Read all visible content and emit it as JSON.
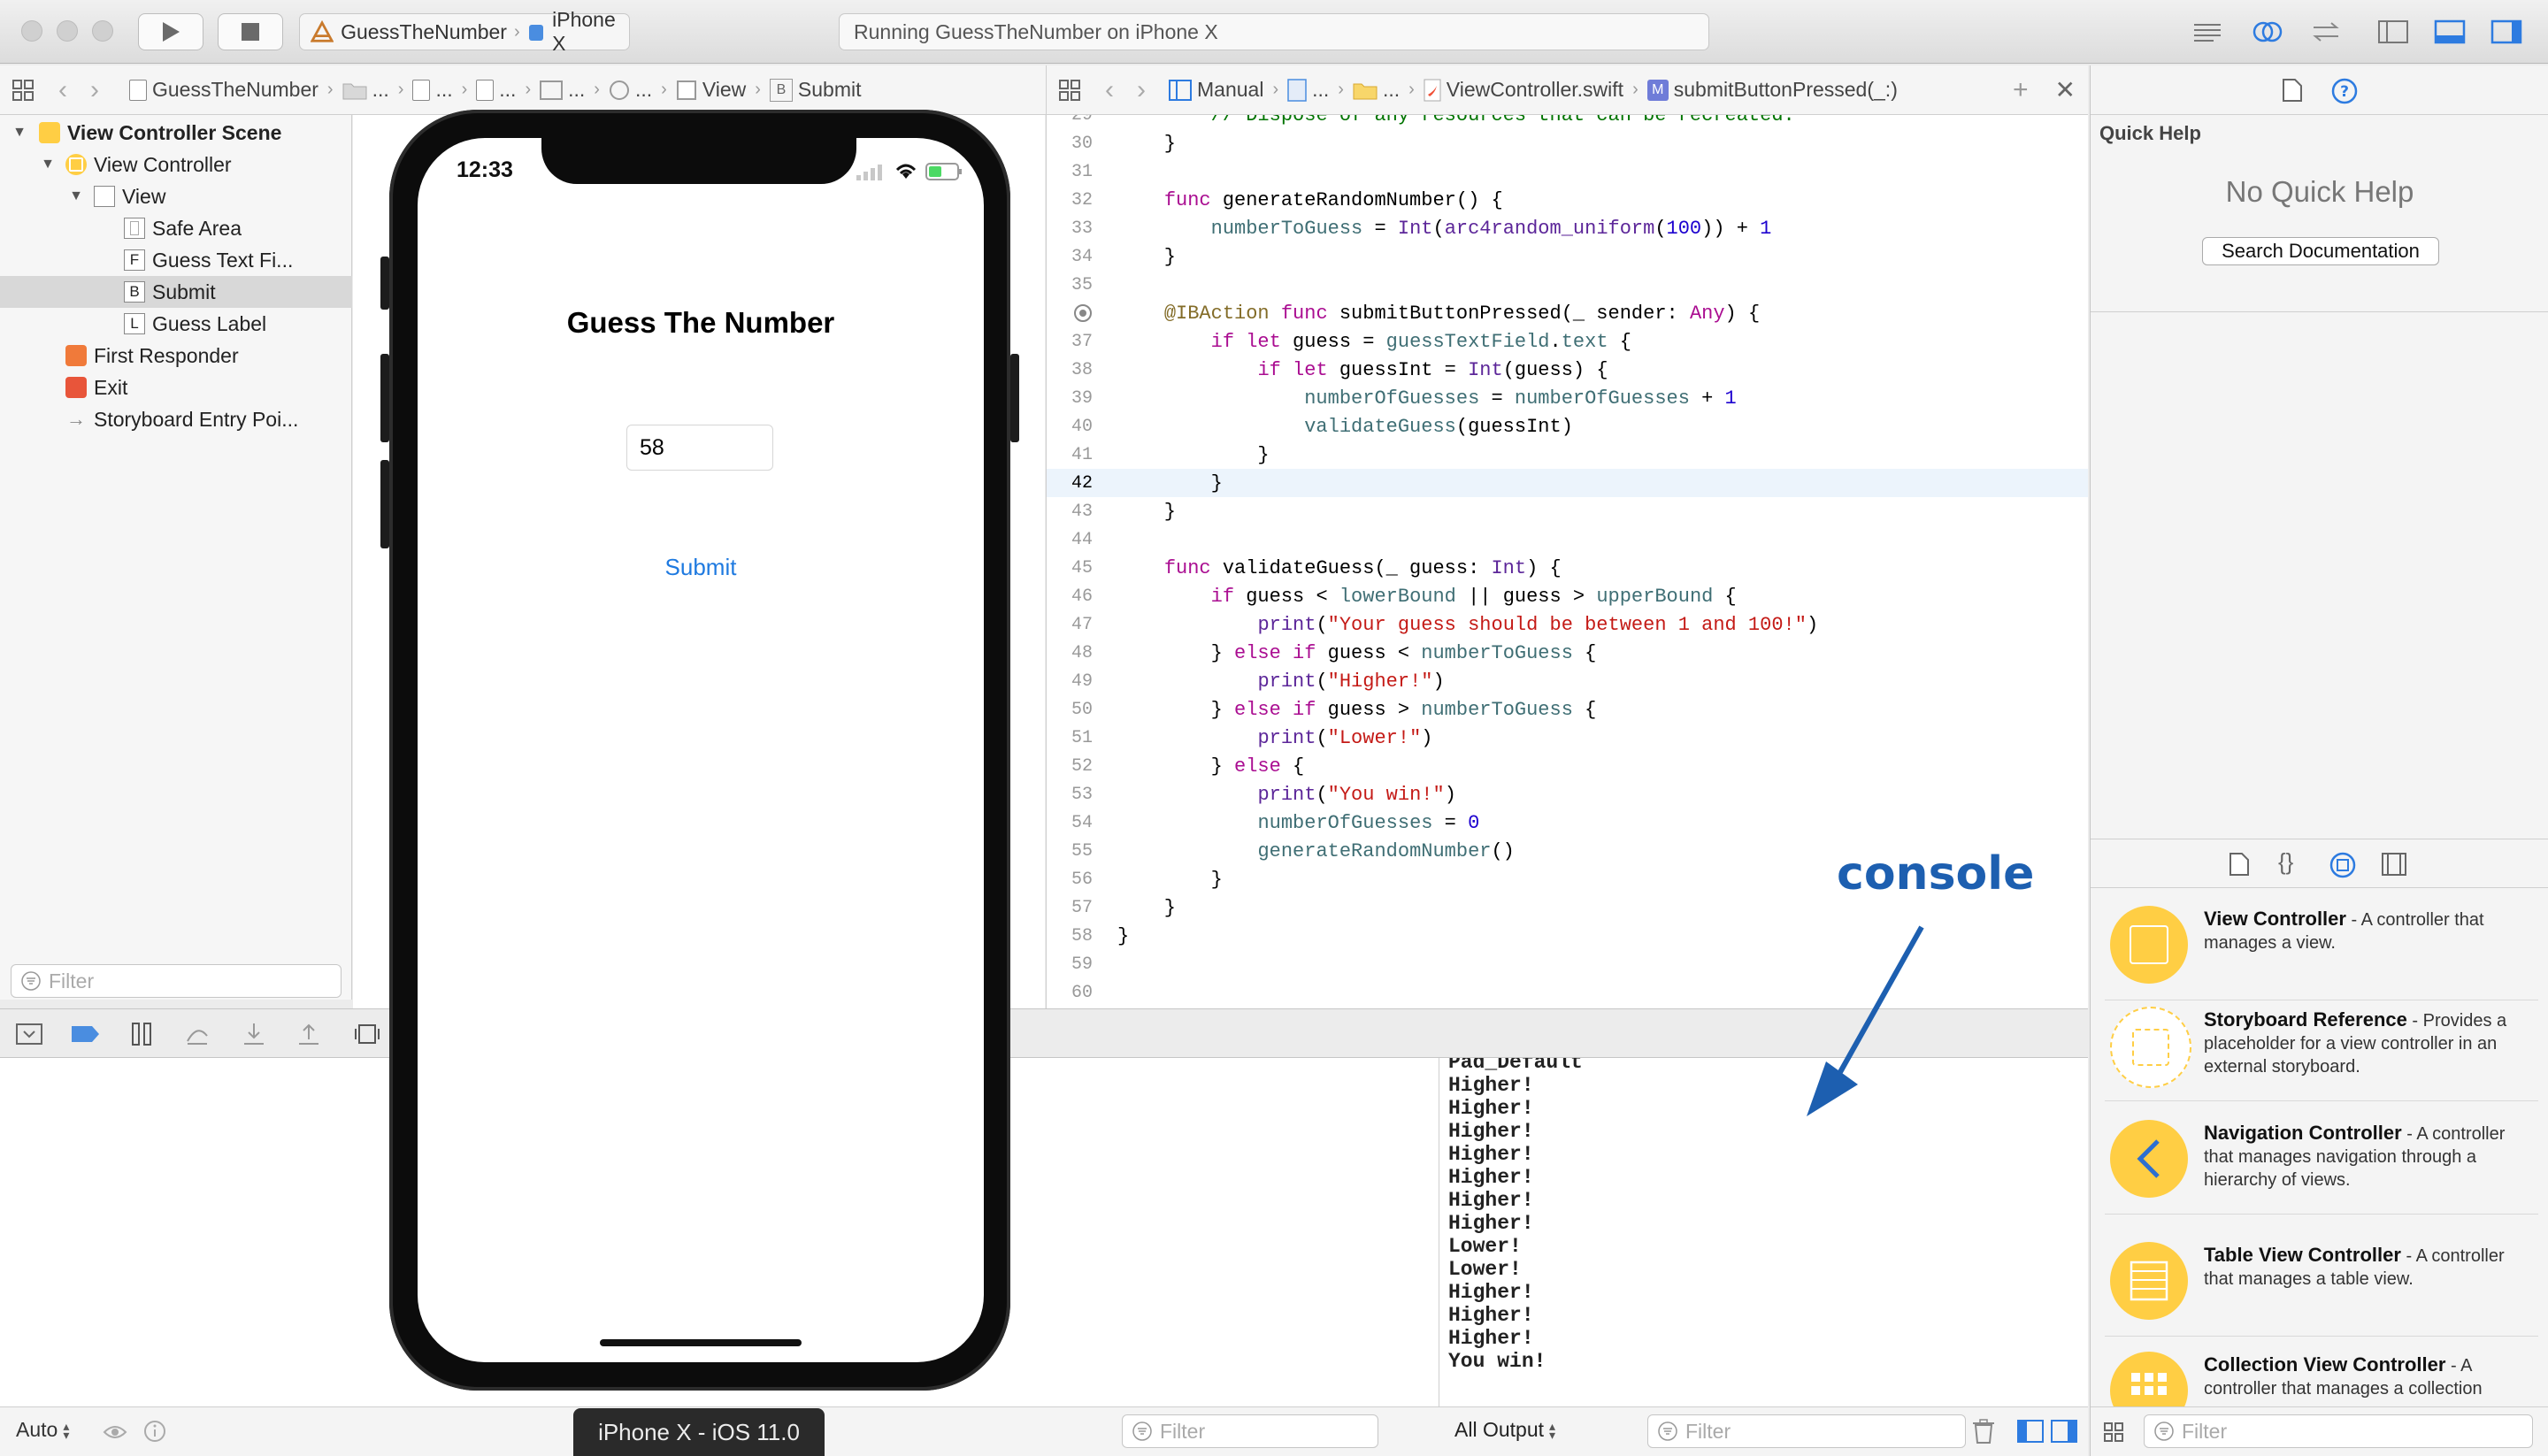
{
  "toolbar": {
    "scheme": "GuessTheNumber",
    "device": "iPhone X",
    "activity": "Running GuessTheNumber on iPhone X"
  },
  "left_jumpbar": {
    "project": "GuessTheNumber",
    "ellipsis": "...",
    "view": "View",
    "submit": "Submit",
    "submit_badge": "B"
  },
  "right_jumpbar": {
    "manual": "Manual",
    "ellipsis": "...",
    "file": "ViewController.swift",
    "method_badge": "M",
    "method": "submitButtonPressed(_:)"
  },
  "outline": {
    "scene": "View Controller Scene",
    "items": [
      {
        "label": "View Controller",
        "icon": "view-controller-icon"
      },
      {
        "label": "View",
        "icon": "view-icon"
      },
      {
        "label": "Safe Area",
        "icon": "safe-area-icon"
      },
      {
        "label": "Guess Text Fi...",
        "icon": "text-field-icon",
        "badge": "F"
      },
      {
        "label": "Submit",
        "icon": "button-icon",
        "badge": "B"
      },
      {
        "label": "Guess Label",
        "icon": "label-icon",
        "badge": "L"
      },
      {
        "label": "First Responder",
        "icon": "first-responder-icon"
      },
      {
        "label": "Exit",
        "icon": "exit-icon"
      },
      {
        "label": "Storyboard Entry Poi...",
        "icon": "entry-point-icon"
      }
    ],
    "filter_placeholder": "Filter"
  },
  "simulator": {
    "time": "12:33",
    "title": "Guess The Number",
    "text_field_value": "58",
    "submit_label": "Submit",
    "device_label": "iPhone X - iOS 11.0"
  },
  "code": {
    "first_line_partial": "// Dispose of any resources that can be recreated.",
    "current_line": 42
  },
  "annotation": {
    "label": "console"
  },
  "console": {
    "lines": [
      "Pad_Default",
      "Higher!",
      "Higher!",
      "Higher!",
      "Higher!",
      "Higher!",
      "Higher!",
      "Higher!",
      "Lower!",
      "Lower!",
      "Higher!",
      "Higher!",
      "Higher!",
      "You win!"
    ],
    "output_select": "All Output",
    "filter_placeholder": "Filter"
  },
  "debug_area": {
    "auto_select": "Auto",
    "filter_placeholder": "Filter"
  },
  "quick_help": {
    "title": "Quick Help",
    "empty": "No Quick Help",
    "search_button": "Search Documentation"
  },
  "library": {
    "items": [
      {
        "name": "View Controller",
        "desc": " - A controller that manages a view."
      },
      {
        "name": "Storyboard Reference",
        "desc": " - Provides a placeholder for a view controller in an external storyboard."
      },
      {
        "name": "Navigation Controller",
        "desc": " - A controller that manages navigation through a hierarchy of views."
      },
      {
        "name": "Table View Controller",
        "desc": " - A controller that manages a table view."
      },
      {
        "name": "Collection View Controller",
        "desc": " - A controller that manages a collection"
      }
    ],
    "filter_placeholder": "Filter"
  },
  "colors": {
    "accent": "#1f7ae0",
    "annotation_blue": "#1d5fb0",
    "library_yellow": "#ffce44"
  }
}
